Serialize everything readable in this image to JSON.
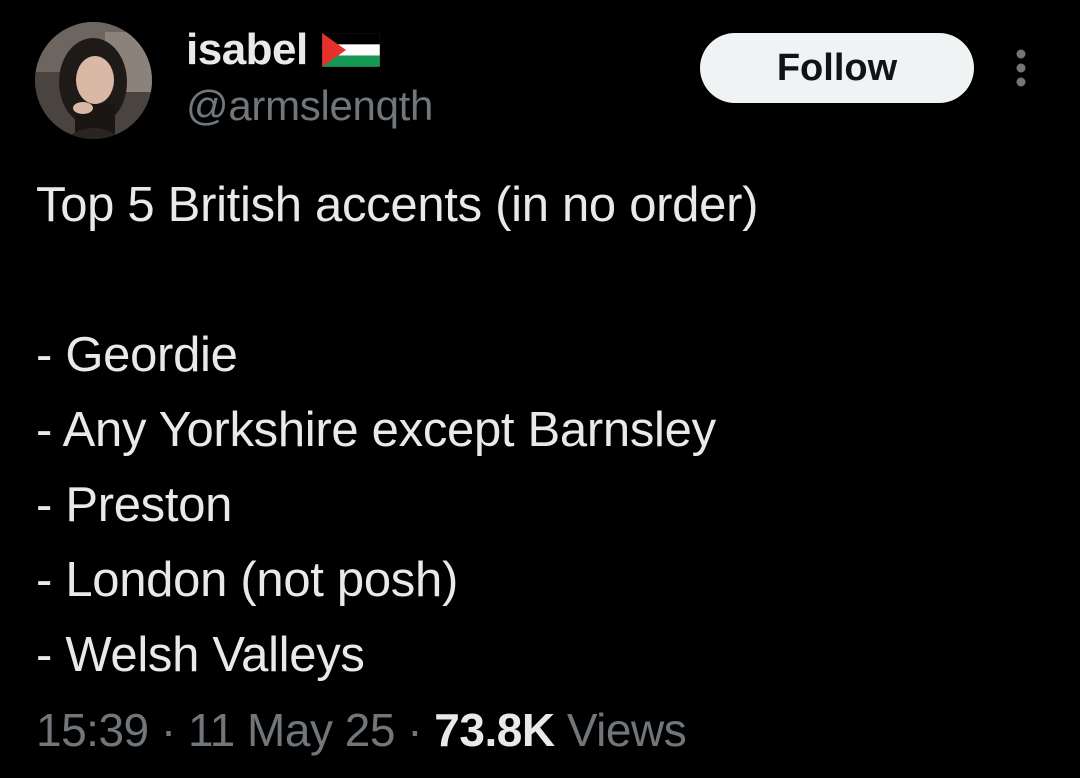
{
  "author": {
    "display_name": "isabel",
    "flag_icon": "palestine-flag-icon",
    "handle": "@armslenqth"
  },
  "actions": {
    "follow_label": "Follow",
    "more_icon": "more-options-icon"
  },
  "tweet": {
    "lines": [
      "Top 5 British accents (in no order)",
      "",
      "- Geordie",
      "- Any Yorkshire except Barnsley",
      "- Preston",
      "- London (not posh)",
      "- Welsh Valleys"
    ]
  },
  "meta": {
    "time": "15:39",
    "separator": "·",
    "date": "11 May 25",
    "views_count": "73.8K",
    "views_label": "Views"
  },
  "colors": {
    "background": "#000000",
    "primary_text": "#e7e9ea",
    "secondary_text": "#71767b",
    "follow_bg": "#eff3f4"
  }
}
